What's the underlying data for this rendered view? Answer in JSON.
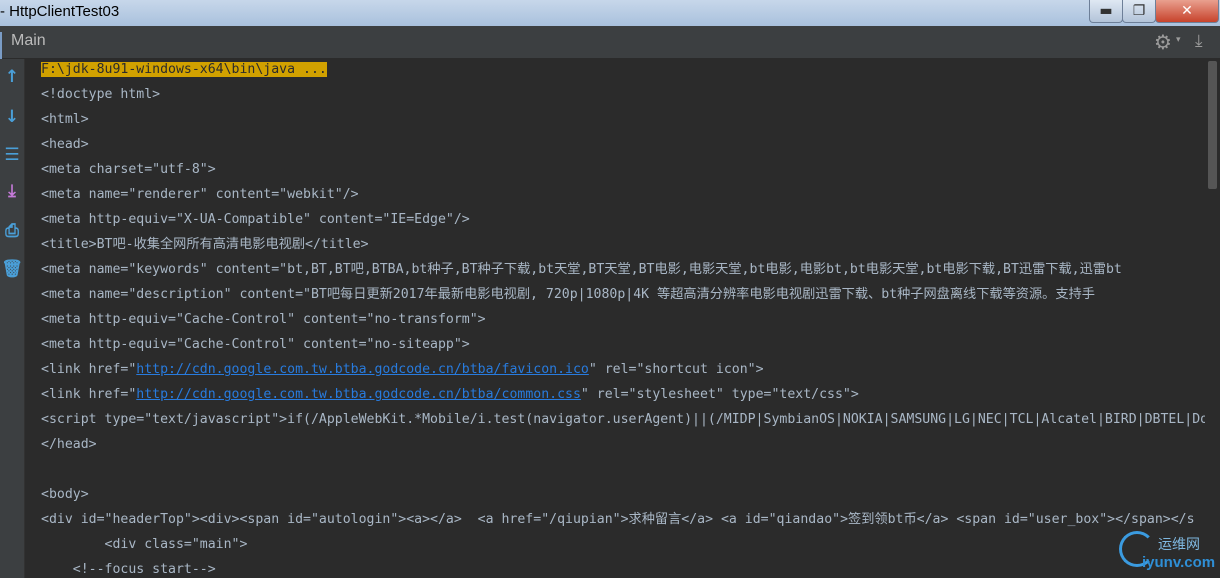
{
  "window": {
    "title": "- HttpClientTest03",
    "minimize_glyph": "▬",
    "maximize_glyph": "❐",
    "close_glyph": "✕"
  },
  "toolbar": {
    "tab_name": "Main",
    "settings_icon": "gear-icon",
    "download_icon": "download-icon"
  },
  "side_tools": [
    {
      "name": "up-arrow-icon",
      "glyph": "↑",
      "color": "#4a9fd8"
    },
    {
      "name": "down-arrow-icon",
      "glyph": "↓",
      "color": "#4a9fd8"
    },
    {
      "name": "soft-wrap-icon",
      "glyph": "☰",
      "color": "#4a9fd8"
    },
    {
      "name": "scroll-to-end-icon",
      "glyph": "⤓",
      "color": "#c47ad8"
    },
    {
      "name": "print-icon",
      "glyph": "⎙",
      "color": "#4a9fd8"
    },
    {
      "name": "trash-icon",
      "glyph": "🗑",
      "color": "#4a9fd8"
    }
  ],
  "console": {
    "lines": [
      {
        "pre": "",
        "hl": "F:\\jdk-8u91-windows-x64\\bin\\java ...",
        "link": "",
        "post": ""
      },
      {
        "pre": "<!doctype html>",
        "hl": "",
        "link": "",
        "post": ""
      },
      {
        "pre": "<html>",
        "hl": "",
        "link": "",
        "post": ""
      },
      {
        "pre": "<head>",
        "hl": "",
        "link": "",
        "post": ""
      },
      {
        "pre": "<meta charset=\"utf-8\">",
        "hl": "",
        "link": "",
        "post": ""
      },
      {
        "pre": "<meta name=\"renderer\" content=\"webkit\"/>",
        "hl": "",
        "link": "",
        "post": ""
      },
      {
        "pre": "<meta http-equiv=\"X-UA-Compatible\" content=\"IE=Edge\"/>",
        "hl": "",
        "link": "",
        "post": ""
      },
      {
        "pre": "<title>BT吧-收集全网所有高清电影电视剧</title>",
        "hl": "",
        "link": "",
        "post": ""
      },
      {
        "pre": "<meta name=\"keywords\" content=\"bt,BT,BT吧,BTBA,bt种子,BT种子下载,bt天堂,BT天堂,BT电影,电影天堂,bt电影,电影bt,bt电影天堂,bt电影下载,BT迅雷下载,迅雷bt",
        "hl": "",
        "link": "",
        "post": ""
      },
      {
        "pre": "<meta name=\"description\" content=\"BT吧每日更新2017年最新电影电视剧, 720p|1080p|4K 等超高清分辨率电影电视剧迅雷下载、bt种子网盘离线下载等资源。支持手",
        "hl": "",
        "link": "",
        "post": ""
      },
      {
        "pre": "<meta http-equiv=\"Cache-Control\" content=\"no-transform\">",
        "hl": "",
        "link": "",
        "post": ""
      },
      {
        "pre": "<meta http-equiv=\"Cache-Control\" content=\"no-siteapp\">",
        "hl": "",
        "link": "",
        "post": ""
      },
      {
        "pre": "<link href=\"",
        "hl": "",
        "link": "http://cdn.google.com.tw.btba.godcode.cn/btba/favicon.ico",
        "post": "\" rel=\"shortcut icon\">"
      },
      {
        "pre": "<link href=\"",
        "hl": "",
        "link": "http://cdn.google.com.tw.btba.godcode.cn/btba/common.css",
        "post": "\" rel=\"stylesheet\" type=\"text/css\">"
      },
      {
        "pre": "<script type=\"text/javascript\">if(/AppleWebKit.*Mobile/i.test(navigator.userAgent)||(/MIDP|SymbianOS|NOKIA|SAMSUNG|LG|NEC|TCL|Alcatel|BIRD|DBTEL|Dop",
        "hl": "",
        "link": "",
        "post": ""
      },
      {
        "pre": "</head>",
        "hl": "",
        "link": "",
        "post": ""
      },
      {
        "pre": "",
        "hl": "",
        "link": "",
        "post": ""
      },
      {
        "pre": "<body>",
        "hl": "",
        "link": "",
        "post": ""
      },
      {
        "pre": "<div id=\"headerTop\"><div><span id=\"autologin\"><a></a>  <a href=\"/qiupian\">求种留言</a> <a id=\"qiandao\">签到领bt币</a> <span id=\"user_box\"></span></s",
        "hl": "",
        "link": "",
        "post": ""
      },
      {
        "pre": "        <div class=\"main\">",
        "hl": "",
        "link": "",
        "post": ""
      },
      {
        "pre": "    <!--focus start-->",
        "hl": "",
        "link": "",
        "post": ""
      }
    ]
  },
  "watermark": {
    "cn": "运维网",
    "en": "iyunv.com"
  }
}
